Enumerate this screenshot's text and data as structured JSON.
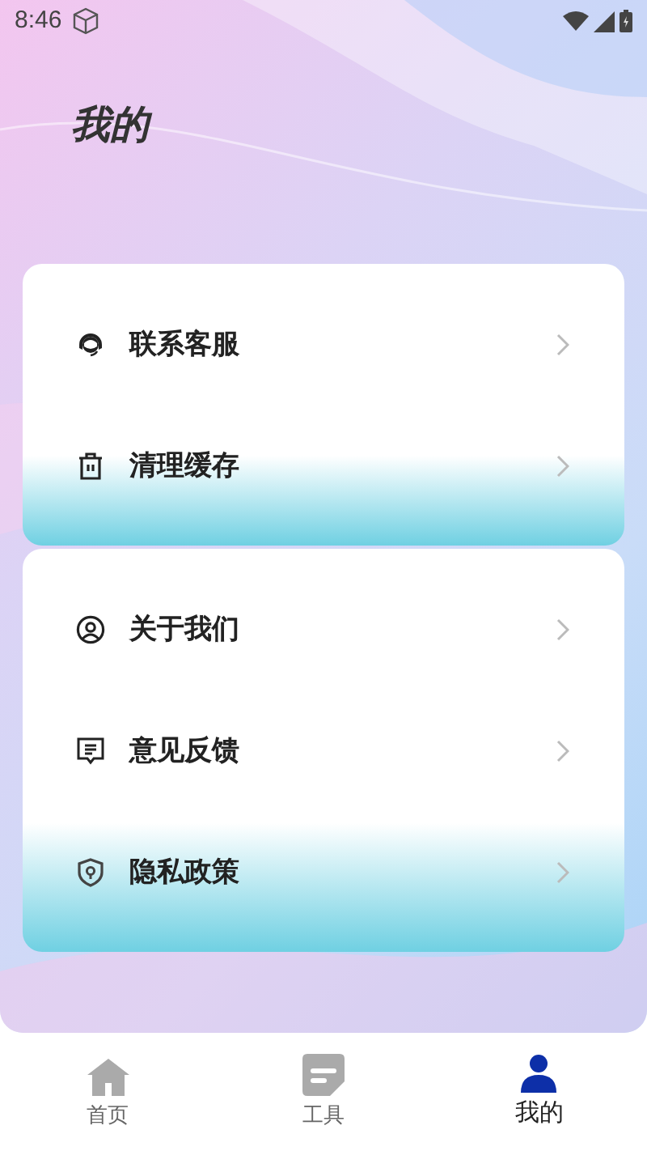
{
  "status_bar": {
    "time": "8:46"
  },
  "title": "我的",
  "menu_groups": [
    {
      "items": [
        {
          "label": "联系客服"
        },
        {
          "label": "清理缓存"
        }
      ]
    },
    {
      "items": [
        {
          "label": "关于我们"
        },
        {
          "label": "意见反馈"
        },
        {
          "label": "隐私政策"
        }
      ]
    }
  ],
  "bottom_nav": [
    {
      "label": "首页",
      "selected": false
    },
    {
      "label": "工具",
      "selected": false
    },
    {
      "label": "我的",
      "selected": true
    }
  ]
}
